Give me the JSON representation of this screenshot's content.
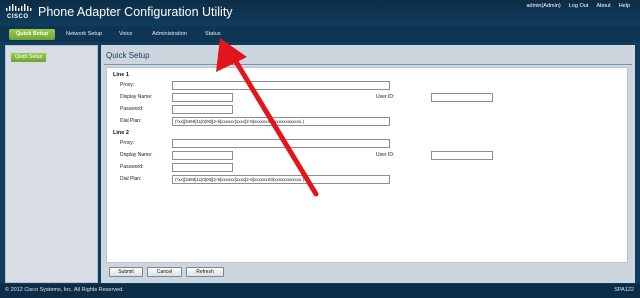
{
  "brand": {
    "logo_text": "CISCO",
    "app_title": "Phone Adapter Configuration Utility"
  },
  "top_links": [
    "admin(Admin)",
    "Log Out",
    "About",
    "Help"
  ],
  "nav": {
    "tabs": [
      "Quick Setup",
      "Network Setup",
      "Voice",
      "Administration",
      "Status"
    ],
    "active": "Quick Setup"
  },
  "sidebar": {
    "items": [
      "Quick Setup"
    ]
  },
  "main": {
    "page_title": "Quick Setup",
    "line1": {
      "title": "Line 1",
      "proxy_label": "Proxy:",
      "proxy_value": "",
      "display_name_label": "Display Name:",
      "display_name_value": "",
      "user_id_label": "User ID:",
      "user_id_value": "",
      "password_label": "Password:",
      "password_value": "",
      "dial_plan_label": "Dial Plan:",
      "dial_plan_value": "(*xx|[3469]11|0|00|[2-9]xxxxxx|1xxx[2-9]xxxxxxS0|xxxxxxxxxxxx.)"
    },
    "line2": {
      "title": "Line 2",
      "proxy_label": "Proxy:",
      "proxy_value": "",
      "display_name_label": "Display Name:",
      "display_name_value": "",
      "user_id_label": "User ID:",
      "user_id_value": "",
      "password_label": "Password:",
      "password_value": "",
      "dial_plan_label": "Dial Plan:",
      "dial_plan_value": "(*xx|[3469]11|0|00|[2-9]xxxxxx|1xxx[2-9]xxxxxxS0|xxxxxxxxxxxx.)"
    },
    "buttons": {
      "submit": "Submit",
      "cancel": "Cancel",
      "refresh": "Refresh"
    }
  },
  "footer": {
    "copyright": "© 2012 Cisco Systems, Inc. All Rights Reserved.",
    "model": "SPA122"
  },
  "colors": {
    "accent_green": "#8bbf45",
    "header_navy": "#0c2d47",
    "arrow_red": "#e3141b"
  },
  "icons": {
    "brand": "cisco-logo",
    "annotation": "red-arrow"
  }
}
